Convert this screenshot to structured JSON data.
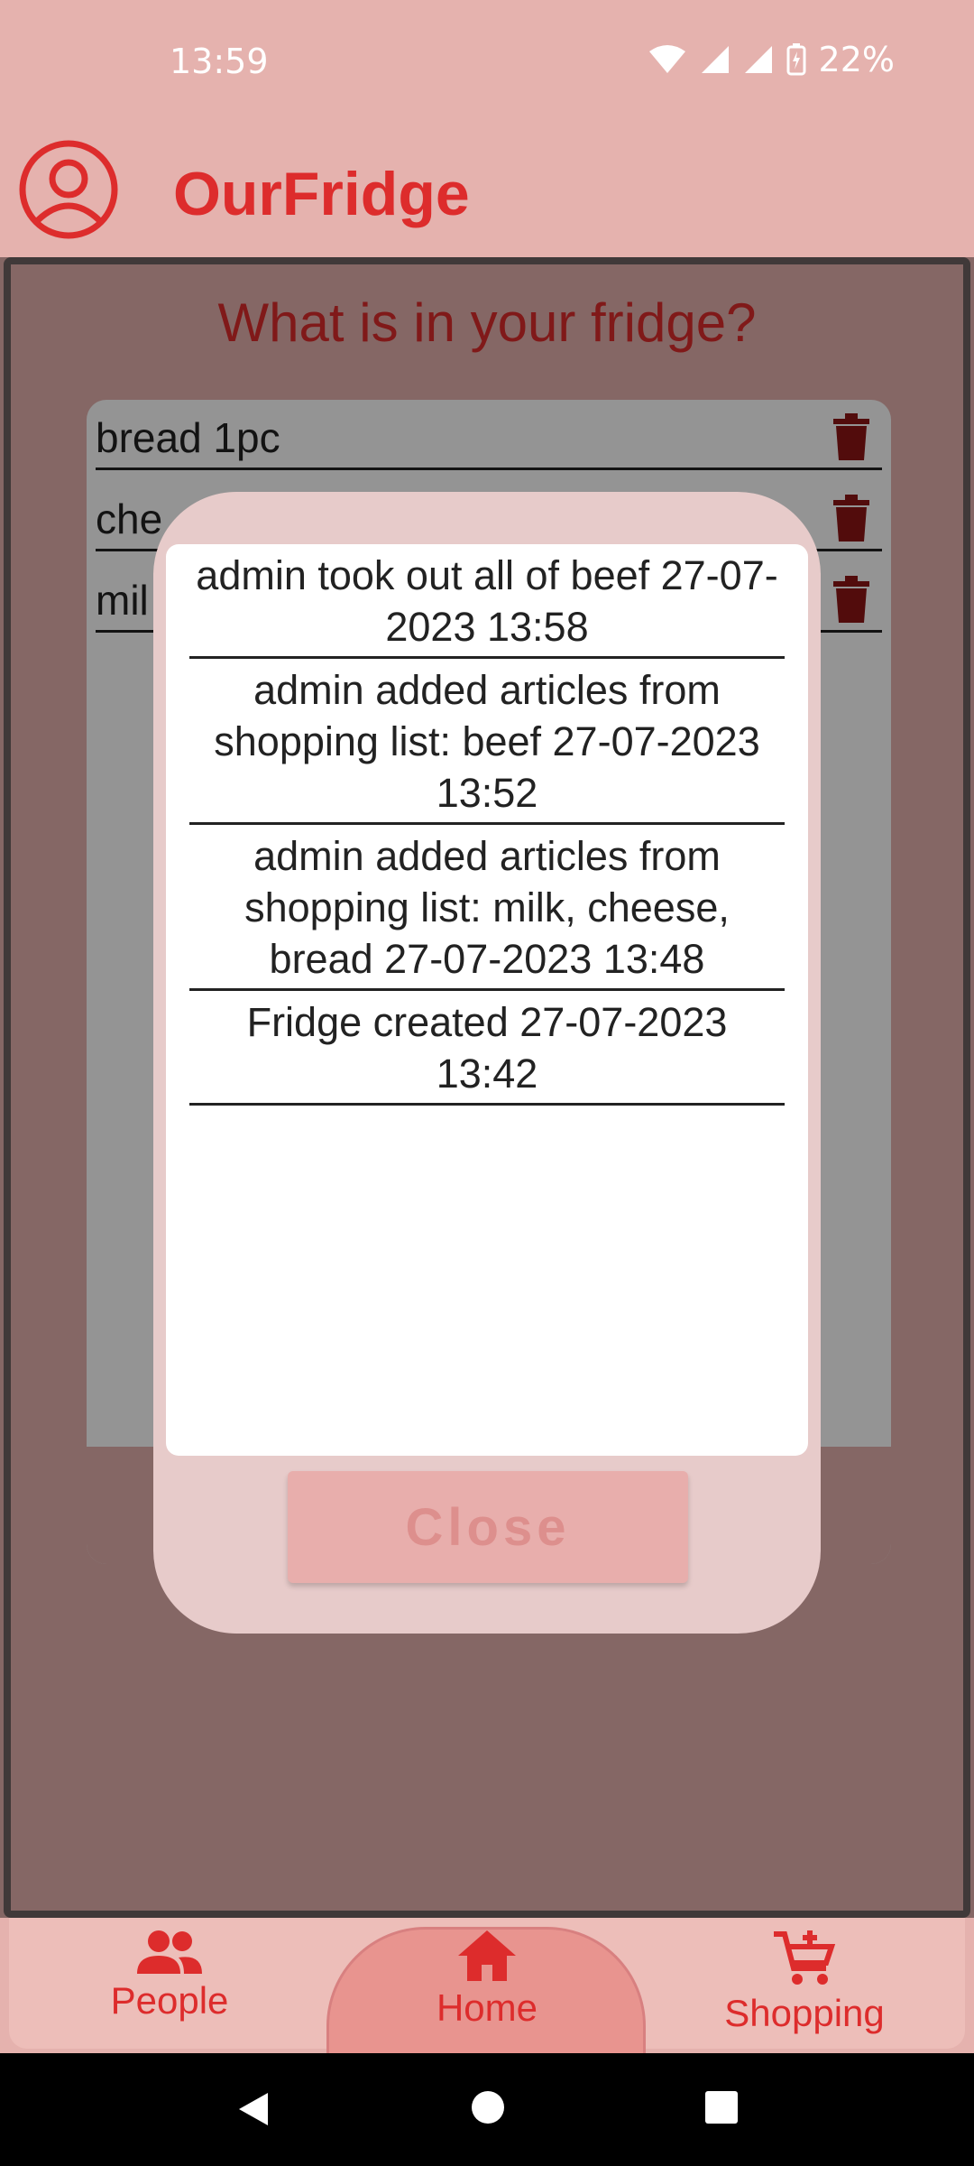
{
  "status_bar": {
    "time": "13:59",
    "battery": "22%"
  },
  "app": {
    "title": "OurFridge"
  },
  "main": {
    "heading": "What is in your fridge?",
    "items": [
      {
        "name": "bread 1pc"
      },
      {
        "name": "che"
      },
      {
        "name": "mil"
      }
    ]
  },
  "dialog": {
    "entries": [
      "admin took out all of beef 27-07-2023 13:58",
      "admin added articles from shopping list: beef 27-07-2023 13:52",
      "admin added articles from shopping list: milk, cheese, bread 27-07-2023 13:48",
      "Fridge created 27-07-2023 13:42"
    ],
    "close_label": "Close"
  },
  "bottom_nav": {
    "people": "People",
    "home": "Home",
    "shopping": "Shopping"
  },
  "colors": {
    "accent": "#dd2c2c",
    "background": "#e5b2ae",
    "dialog_bg": "#e7cbca",
    "trash": "#8e1515"
  },
  "icons": {
    "profile": "account-circle-icon",
    "trash": "trash-icon",
    "people": "people-icon",
    "home": "home-icon",
    "shopping": "add-shopping-cart-icon"
  }
}
